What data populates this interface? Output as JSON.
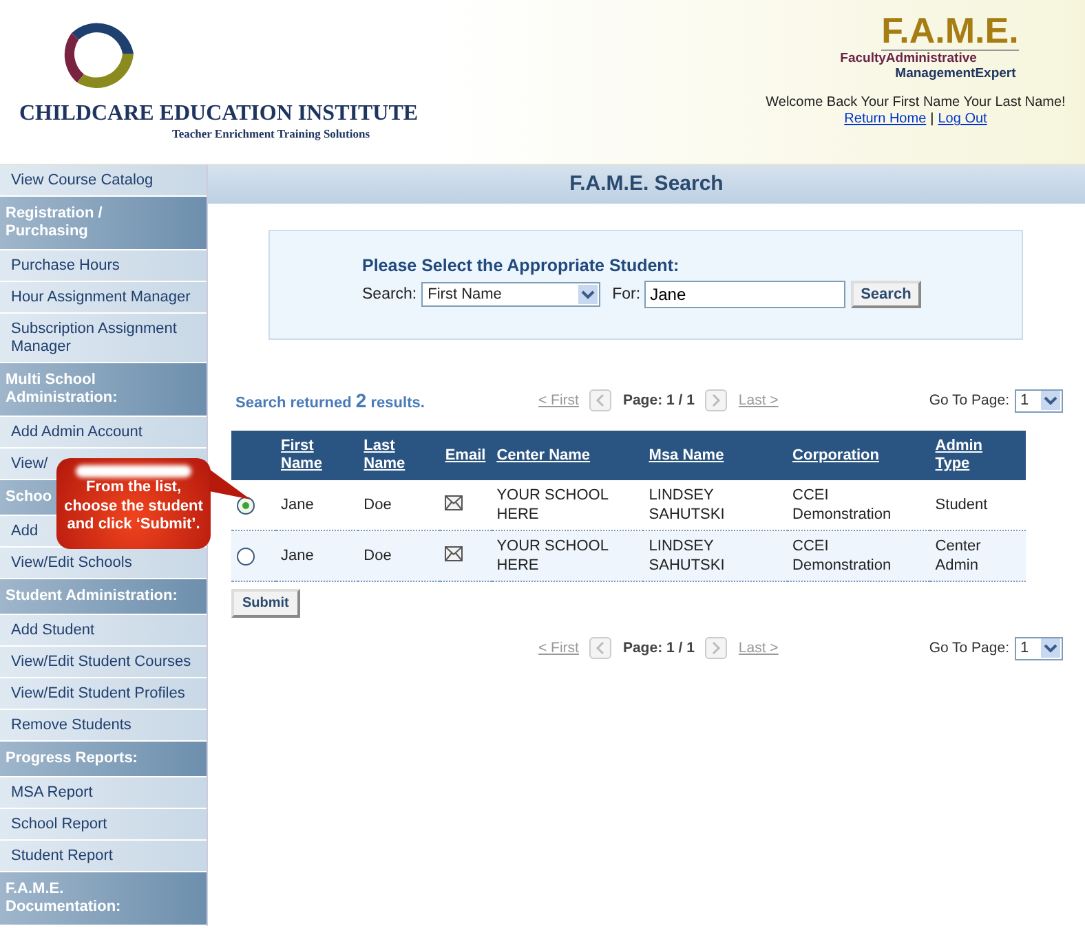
{
  "header": {
    "logo_name": "CHILDCARE EDUCATION INSTITUTE",
    "tagline": "Teacher Enrichment Training Solutions",
    "fame_logo": {
      "title": "F.A.M.E.",
      "line_1": "FacultyAdministrative",
      "line_2": "ManagementExpert"
    },
    "welcome": "Welcome Back Your First Name Your Last Name!",
    "links": [
      "Return Home",
      "Log Out"
    ],
    "separator": "|"
  },
  "sidebar": [
    {
      "kind": "link",
      "label": "View Course Catalog"
    },
    {
      "kind": "heading",
      "label": "Registration / Purchasing"
    },
    {
      "kind": "link",
      "label": "Purchase Hours"
    },
    {
      "kind": "link",
      "label": "Hour Assignment Manager"
    },
    {
      "kind": "link",
      "label": "Subscription Assignment Manager"
    },
    {
      "kind": "heading",
      "label": "Multi School Administration:"
    },
    {
      "kind": "link",
      "label": "Add Admin Account"
    },
    {
      "kind": "link",
      "label": "View/"
    },
    {
      "kind": "heading",
      "label": "Schoo"
    },
    {
      "kind": "link",
      "label": "Add"
    },
    {
      "kind": "link",
      "label": "View/Edit Schools"
    },
    {
      "kind": "heading",
      "label": "Student Administration:"
    },
    {
      "kind": "link",
      "label": "Add Student"
    },
    {
      "kind": "link",
      "label": "View/Edit Student Courses"
    },
    {
      "kind": "link",
      "label": "View/Edit Student Profiles"
    },
    {
      "kind": "link",
      "label": "Remove Students"
    },
    {
      "kind": "heading",
      "label": "Progress Reports:"
    },
    {
      "kind": "link",
      "label": "MSA Report"
    },
    {
      "kind": "link",
      "label": "School Report"
    },
    {
      "kind": "link",
      "label": "Student Report"
    },
    {
      "kind": "heading",
      "label": "F.A.M.E. Documentation:"
    }
  ],
  "page_title": "F.A.M.E. Search",
  "search_panel": {
    "heading": "Please Select the Appropriate Student:",
    "search_label": "Search:",
    "search_by": "First Name",
    "for_label": "For:",
    "query": "Jane",
    "button": "Search"
  },
  "results": {
    "prefix": "Search returned",
    "count": "2",
    "suffix": "results."
  },
  "pagination": [
    {
      "first": "< First",
      "page_label": "Page:",
      "page": "1 / 1",
      "last": "Last >",
      "goto_label": "Go To Page:",
      "goto_value": "1"
    },
    {
      "first": "< First",
      "page_label": "Page:",
      "page": "1 / 1",
      "last": "Last >",
      "goto_label": "Go To Page:",
      "goto_value": "1"
    }
  ],
  "table": {
    "columns": [
      "First Name",
      "Last Name",
      "Email",
      "Center Name",
      "Msa Name",
      "Corporation",
      "Admin Type"
    ],
    "rows": [
      {
        "selected": true,
        "first": "Jane",
        "last": "Doe",
        "center": "YOUR SCHOOL HERE",
        "msa": "LINDSEY SAHUTSKI",
        "corporation": "CCEI Demonstration",
        "admin_type": "Student"
      },
      {
        "selected": false,
        "first": "Jane",
        "last": "Doe",
        "center": "YOUR SCHOOL HERE",
        "msa": "LINDSEY SAHUTSKI",
        "corporation": "CCEI Demonstration",
        "admin_type": "Center Admin"
      }
    ]
  },
  "submit": "Submit",
  "callout": "From the list, choose the student and click ‘Submit’."
}
